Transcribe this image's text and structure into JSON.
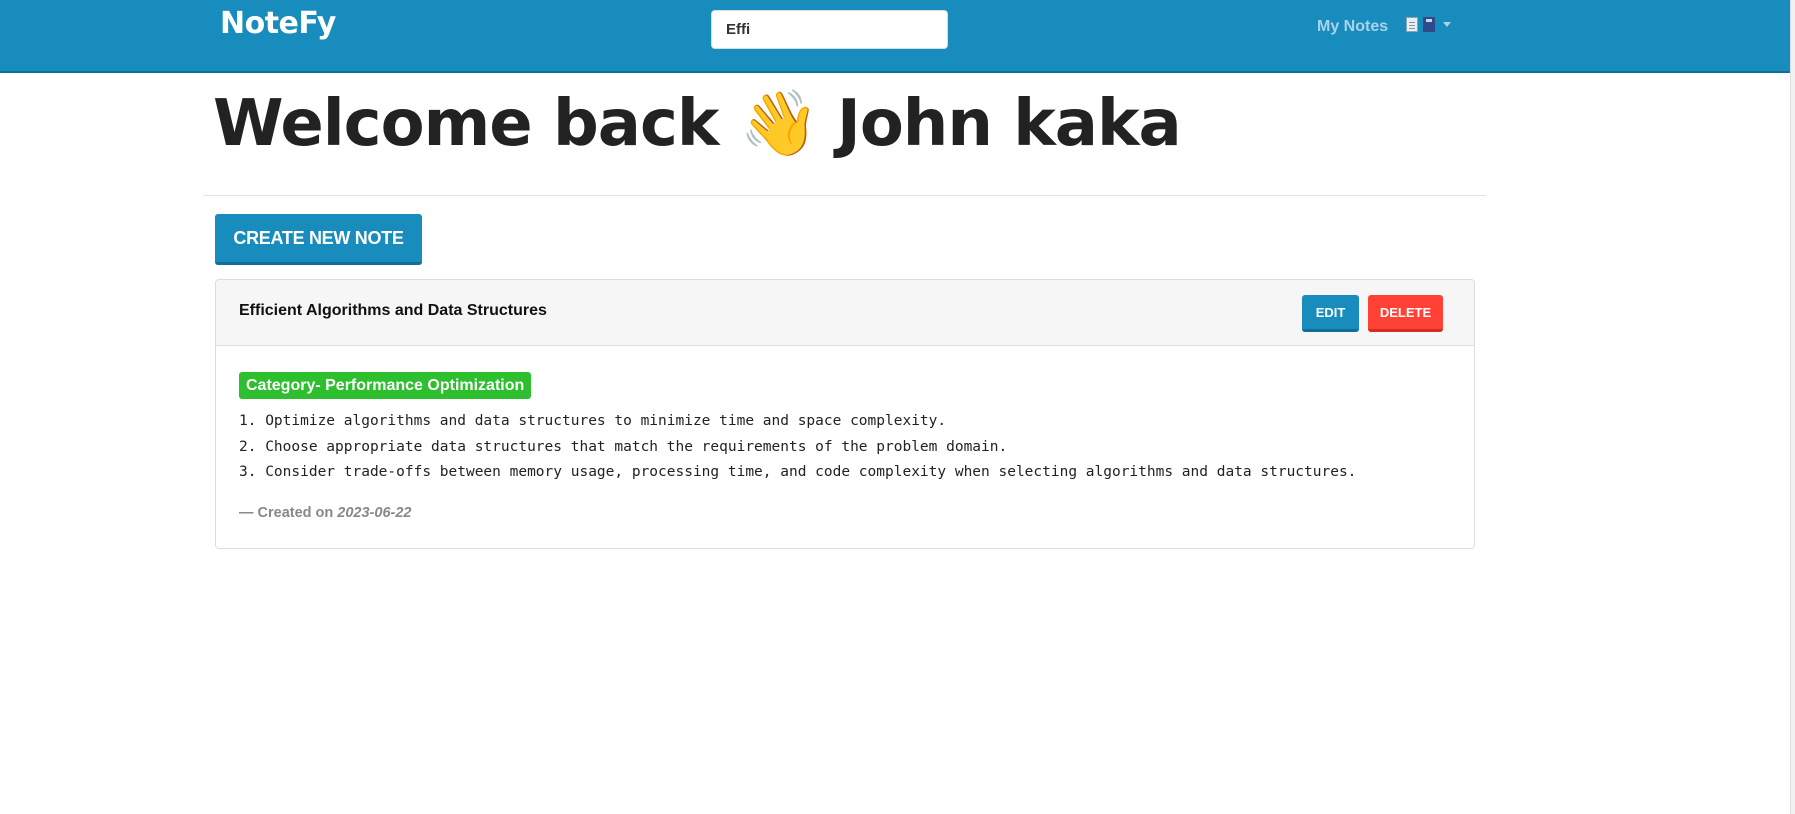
{
  "navbar": {
    "brand": "NoteFy",
    "search": {
      "value": "Effi",
      "placeholder": ""
    },
    "my_notes_label": "My Notes",
    "user_icons": [
      "document-icon",
      "book-icon"
    ],
    "colors": {
      "primary": "#178cbd"
    }
  },
  "main": {
    "welcome_prefix": "Welcome back",
    "wave_emoji": "👋",
    "user_name": "John kaka",
    "create_button_label": "CREATE NEW NOTE"
  },
  "notes": [
    {
      "title": "Efficient Algorithms and Data Structures",
      "edit_label": "EDIT",
      "delete_label": "DELETE",
      "category": "Category- Performance Optimization",
      "lines": [
        "1. Optimize algorithms and data structures to minimize time and space complexity.",
        "2. Choose appropriate data structures that match the requirements of the problem domain.",
        "3. Consider trade-offs between memory usage, processing time, and code complexity when selecting algorithms and data structures."
      ],
      "created_prefix": "— Created on",
      "created_date": "2023-06-22"
    }
  ]
}
